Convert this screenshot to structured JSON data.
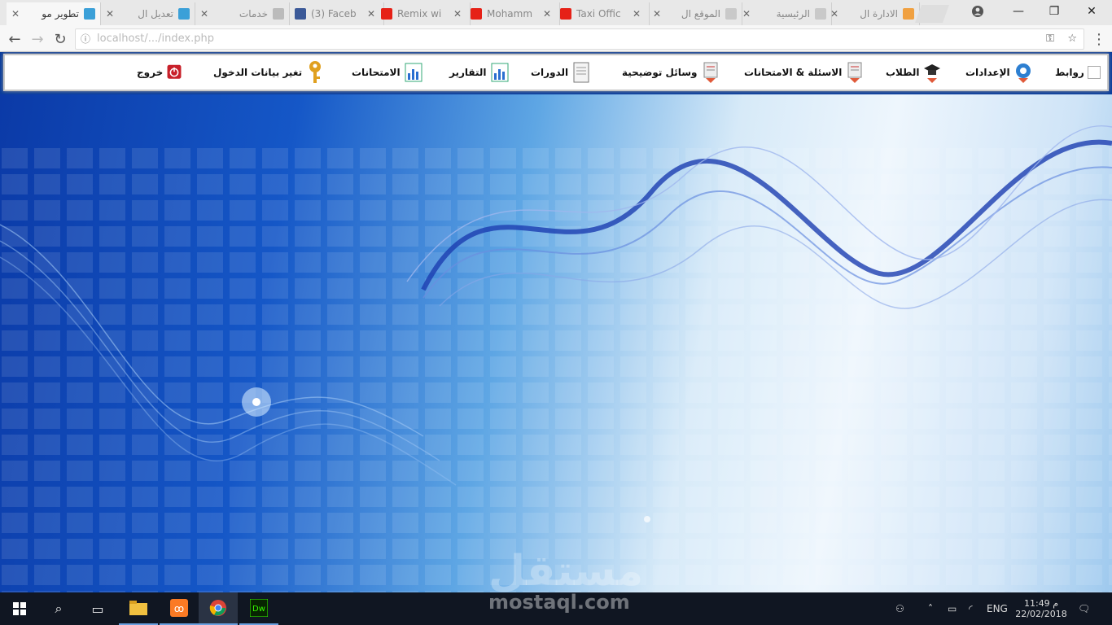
{
  "browser": {
    "tabs": [
      {
        "title": "تطوير مو",
        "color": "#3ba0d8"
      },
      {
        "title": "تعديل ال",
        "color": "#3ba0d8"
      },
      {
        "title": "خدمات",
        "color": "#bbb"
      },
      {
        "title": "(3) Faceb",
        "color": "#3b5998"
      },
      {
        "title": "Remix wi",
        "color": "#e62117"
      },
      {
        "title": "Mohamm",
        "color": "#e62117"
      },
      {
        "title": "Taxi Offic",
        "color": "#e62117"
      },
      {
        "title": "الموقع ال",
        "color": "#c9c9c9"
      },
      {
        "title": "الرئيسية",
        "color": "#c9c9c9"
      },
      {
        "title": "الادارة ال",
        "color": "#f0a040"
      }
    ],
    "url": "localhost/.../index.php"
  },
  "menu": {
    "items": [
      {
        "label": "روابط",
        "icon": "broken-image-icon"
      },
      {
        "label": "الإعدادات",
        "icon": "settings-gear-icon"
      },
      {
        "label": "الطلاب",
        "icon": "graduate-cap-icon"
      },
      {
        "label": "الاسئلة & الامتحانات",
        "icon": "document-dropdown-icon"
      },
      {
        "label": "وسائل توضيحية",
        "icon": "document-dropdown-icon"
      },
      {
        "label": "الدورات",
        "icon": "document-icon"
      },
      {
        "label": "التقارير",
        "icon": "report-chart-icon"
      },
      {
        "label": "الامتحانات",
        "icon": "report-chart-icon"
      },
      {
        "label": "تغير بيانات الدخول",
        "icon": "key-icon"
      },
      {
        "label": "خروج",
        "icon": "power-icon"
      }
    ]
  },
  "taskbar": {
    "language": "ENG",
    "time": "11:49 م",
    "date": "22/02/2018"
  },
  "watermark": {
    "arabic": "مستقل",
    "latin": "mostaql.com"
  },
  "colors": {
    "menu_bg": "#ffffff",
    "hero_dark": "#0b3aa7",
    "taskbar": "#101622"
  }
}
